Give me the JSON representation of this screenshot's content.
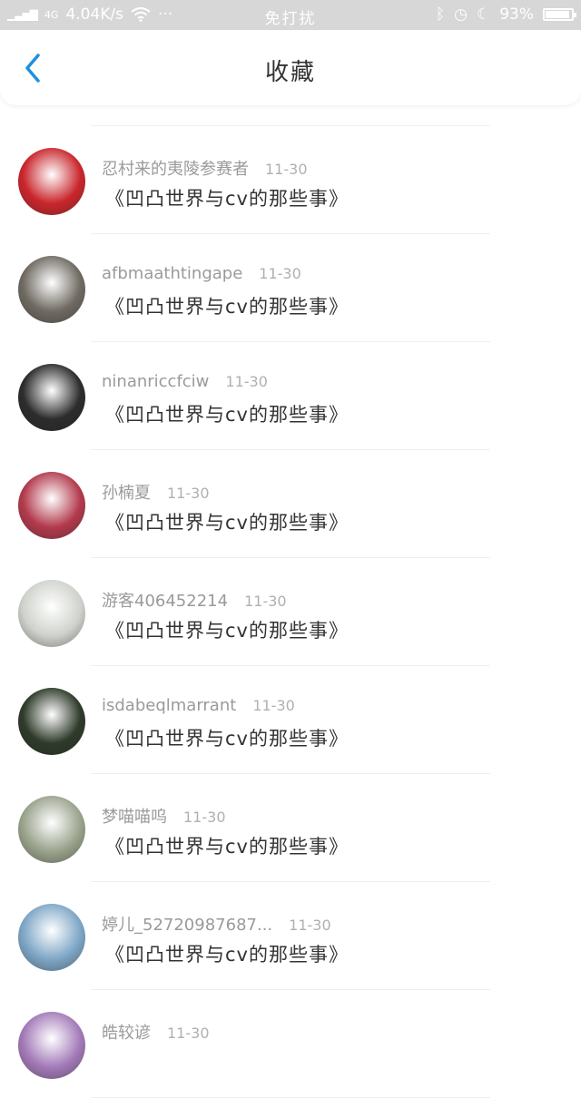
{
  "status_bar": {
    "signal": "4G",
    "speed": "4.04K/s",
    "more": "···",
    "mode": "免打扰",
    "battery": "93%",
    "battery_level": 0.93
  },
  "header": {
    "title": "收藏"
  },
  "favorites": [
    {
      "user": "忍村来的夷陵参赛者",
      "date": "11-30",
      "book": "《凹凸世界与cv的那些事》",
      "avatar_color": "#c9262c"
    },
    {
      "user": "afbmaathtingape",
      "date": "11-30",
      "book": "《凹凸世界与cv的那些事》",
      "avatar_color": "#6f6a62"
    },
    {
      "user": "ninanriccfciw",
      "date": "11-30",
      "book": "《凹凸世界与cv的那些事》",
      "avatar_color": "#2c2c2c"
    },
    {
      "user": "孙楠夏",
      "date": "11-30",
      "book": "《凹凸世界与cv的那些事》",
      "avatar_color": "#b23a4c"
    },
    {
      "user": "游客406452214",
      "date": "11-30",
      "book": "《凹凸世界与cv的那些事》",
      "avatar_color": "#cfd3cc"
    },
    {
      "user": "isdabeqlmarrant",
      "date": "11-30",
      "book": "《凹凸世界与cv的那些事》",
      "avatar_color": "#2e3a2a"
    },
    {
      "user": "梦喵喵呜",
      "date": "11-30",
      "book": "《凹凸世界与cv的那些事》",
      "avatar_color": "#9aa38c"
    },
    {
      "user": "婷儿_52720987687...",
      "date": "11-30",
      "book": "《凹凸世界与cv的那些事》",
      "avatar_color": "#7ea6c6"
    },
    {
      "user": "皓较谚",
      "date": "11-30",
      "book": "",
      "avatar_color": "#a37ab8"
    }
  ]
}
